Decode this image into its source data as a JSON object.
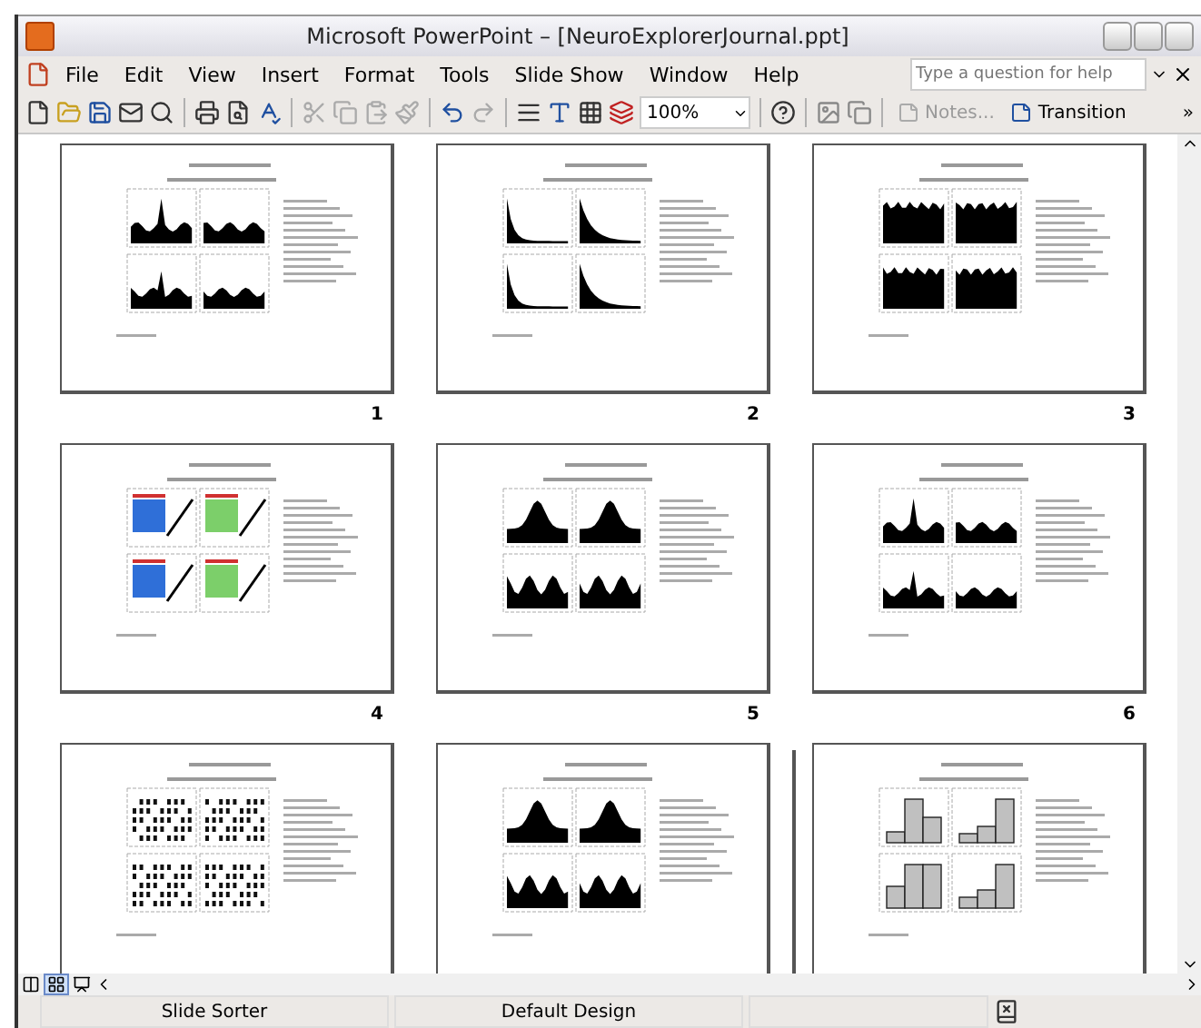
{
  "window": {
    "title": "Microsoft PowerPoint – [NeuroExplorerJournal.ppt]"
  },
  "menu": [
    {
      "label": "File"
    },
    {
      "label": "Edit"
    },
    {
      "label": "View"
    },
    {
      "label": "Insert"
    },
    {
      "label": "Format"
    },
    {
      "label": "Tools"
    },
    {
      "label": "Slide Show"
    },
    {
      "label": "Window"
    },
    {
      "label": "Help"
    }
  ],
  "help_box": {
    "placeholder": "Type a question for help"
  },
  "toolbar": {
    "zoom": "100%",
    "buttons": [
      {
        "label": "Notes...",
        "disabled": true
      },
      {
        "label": "Transition",
        "disabled": false
      }
    ],
    "overflow": "»"
  },
  "slides": [
    {
      "number": "1",
      "kind": "histogram",
      "insertion_before": false
    },
    {
      "number": "2",
      "kind": "decay",
      "insertion_before": false
    },
    {
      "number": "3",
      "kind": "flat",
      "insertion_before": false
    },
    {
      "number": "4",
      "kind": "heatmap",
      "insertion_before": false
    },
    {
      "number": "5",
      "kind": "peak",
      "insertion_before": false
    },
    {
      "number": "6",
      "kind": "histogram",
      "insertion_before": false
    },
    {
      "kind": "raster",
      "insertion_before": false
    },
    {
      "kind": "peak",
      "insertion_before": false
    },
    {
      "kind": "bars",
      "insertion_before": true
    }
  ],
  "view_buttons": [
    {
      "kind": "normal",
      "selected": false
    },
    {
      "kind": "sorter",
      "selected": true
    },
    {
      "kind": "show",
      "selected": false
    }
  ],
  "status_bar": [
    "Slide Sorter",
    "Default Design"
  ]
}
